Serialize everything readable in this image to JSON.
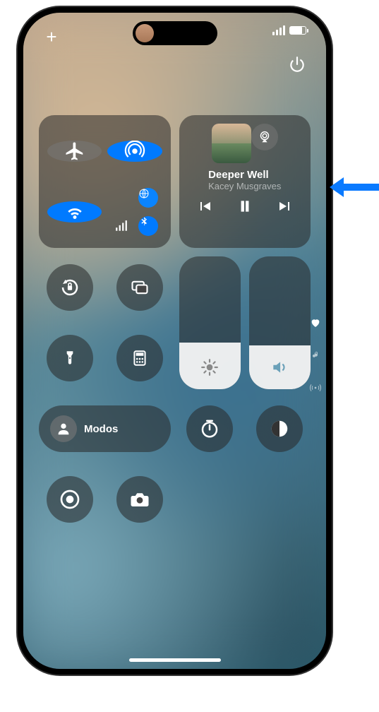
{
  "status": {
    "battery_pct": 75
  },
  "top": {
    "add_label": "+"
  },
  "connectivity": {
    "airplane": false,
    "airdrop": true,
    "wifi": true,
    "cellular_bars": 4,
    "bluetooth": true,
    "personal_hotspot": true
  },
  "media": {
    "track_title": "Deeper Well",
    "track_artist": "Kacey Musgraves",
    "playing": false
  },
  "sliders": {
    "brightness_pct": 35,
    "volume_pct": 33
  },
  "focus": {
    "label": "Modos"
  },
  "colors": {
    "accent_blue": "#007aff"
  }
}
